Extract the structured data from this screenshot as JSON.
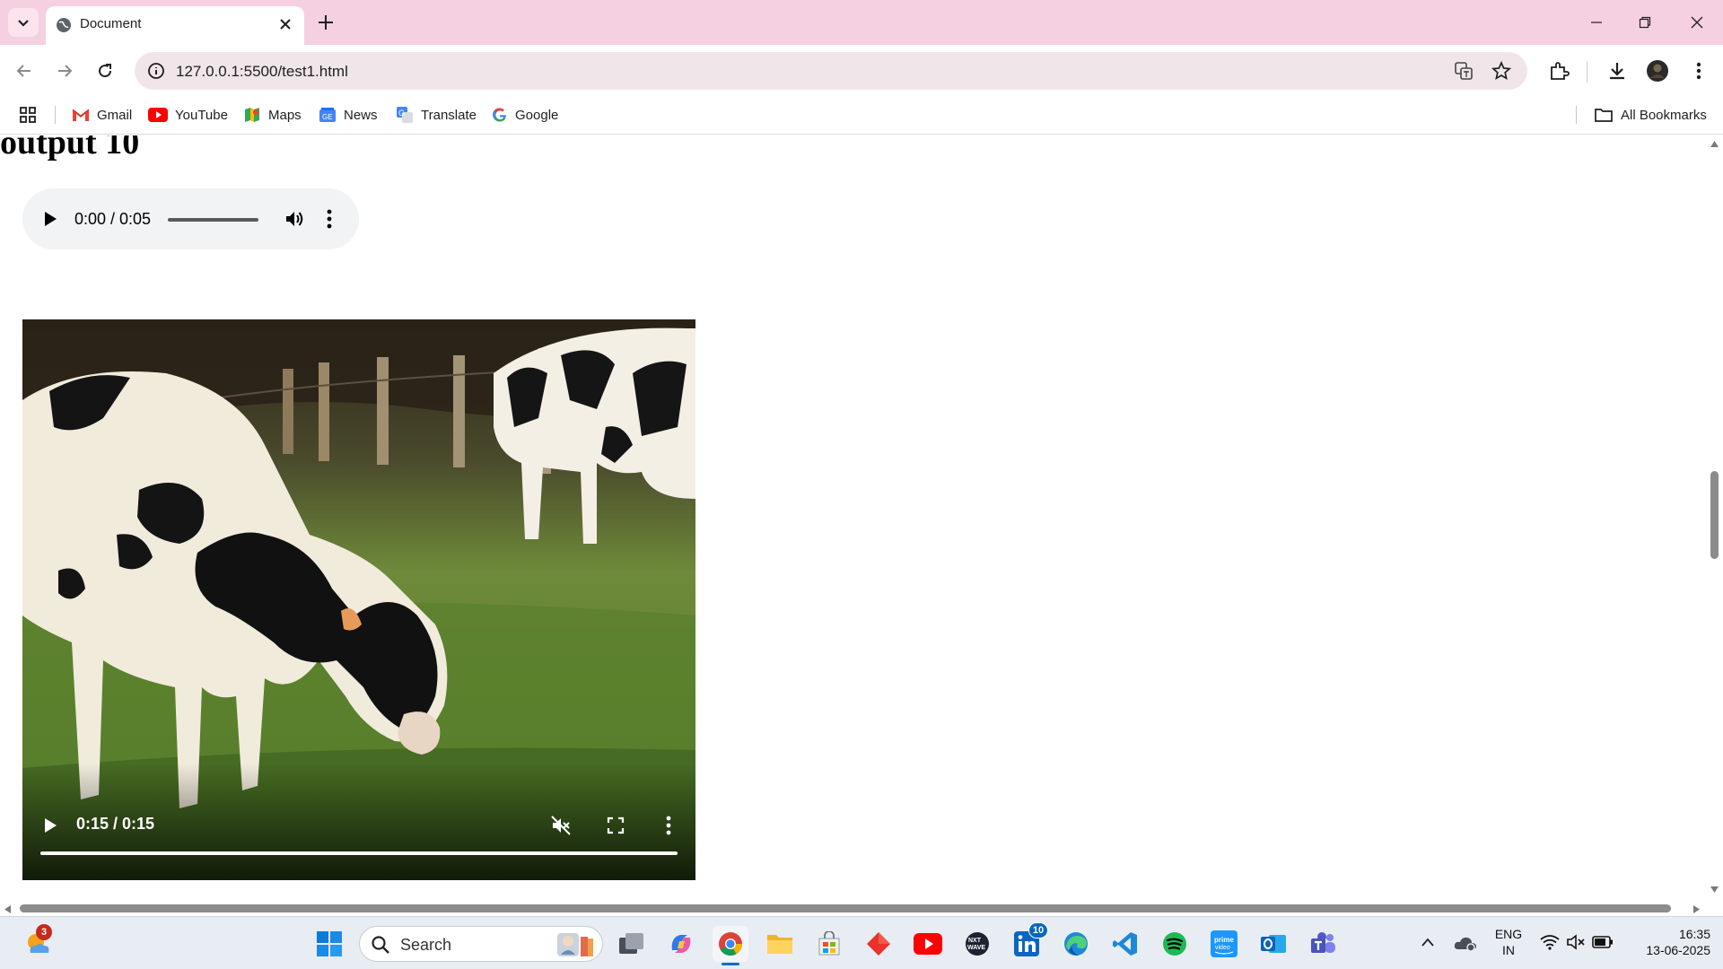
{
  "browser": {
    "tab_title": "Document",
    "url": "127.0.0.1:5500/test1.html",
    "bookmarks": [
      {
        "label": "Gmail",
        "icon": "gmail-icon"
      },
      {
        "label": "YouTube",
        "icon": "youtube-icon"
      },
      {
        "label": "Maps",
        "icon": "maps-icon"
      },
      {
        "label": "News",
        "icon": "news-icon"
      },
      {
        "label": "Translate",
        "icon": "translate-icon"
      },
      {
        "label": "Google",
        "icon": "google-icon"
      }
    ],
    "all_bookmarks_label": "All Bookmarks",
    "colors": {
      "titlebar": "#f5d0e0",
      "omnibox": "#f0e6ea"
    }
  },
  "page": {
    "heading": "output 10",
    "audio": {
      "time": "0:00 / 0:05",
      "progress": 0
    },
    "video": {
      "time": "0:15 / 0:15",
      "progress": 1.0,
      "muted": true
    }
  },
  "taskbar": {
    "search_label": "Search",
    "weather_badge": "3",
    "linkedin_badge": "10",
    "language": "ENG",
    "region": "IN",
    "time": "16:35",
    "date": "13-06-2025"
  }
}
